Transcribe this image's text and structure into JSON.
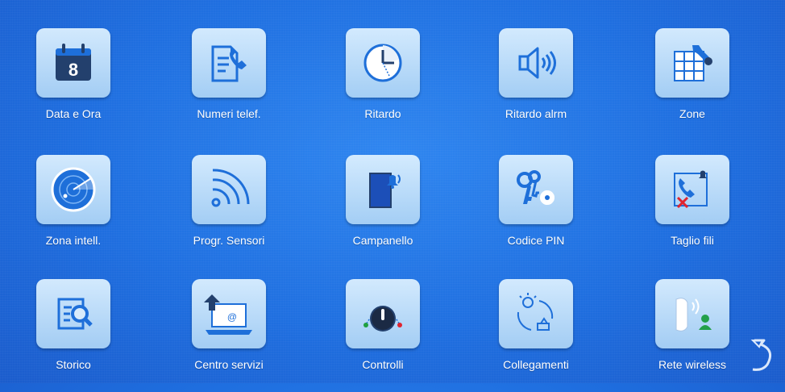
{
  "tiles": [
    {
      "label": "Data e Ora",
      "icon": "calendar-icon",
      "calendar_day": "8"
    },
    {
      "label": "Numeri telef.",
      "icon": "phone-book-icon"
    },
    {
      "label": "Ritardo",
      "icon": "clock-icon"
    },
    {
      "label": "Ritardo alrm",
      "icon": "speaker-icon"
    },
    {
      "label": "Zone",
      "icon": "grid-wrench-icon"
    },
    {
      "label": "Zona intell.",
      "icon": "radar-icon"
    },
    {
      "label": "Progr. Sensori",
      "icon": "sensor-signal-icon"
    },
    {
      "label": "Campanello",
      "icon": "doorbell-icon"
    },
    {
      "label": "Codice PIN",
      "icon": "keys-gear-icon"
    },
    {
      "label": "Taglio fili",
      "icon": "cut-wire-phone-icon"
    },
    {
      "label": "Storico",
      "icon": "history-search-icon"
    },
    {
      "label": "Centro servizi",
      "icon": "laptop-upload-icon"
    },
    {
      "label": "Controlli",
      "icon": "knob-icon"
    },
    {
      "label": "Collegamenti",
      "icon": "linkage-icon"
    },
    {
      "label": "Rete wireless",
      "icon": "wireless-icon"
    }
  ],
  "nav": {
    "back_icon": "back-arrow-icon"
  },
  "colors": {
    "background": "#1f6fe0",
    "tile": "#cfe6fb",
    "icon_blue": "#1e6fd9",
    "icon_navy": "#23406d"
  }
}
